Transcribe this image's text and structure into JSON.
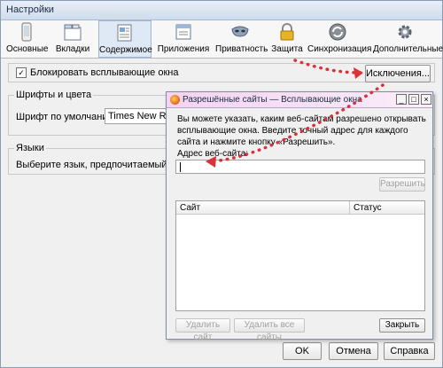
{
  "window": {
    "title": "Настройки"
  },
  "toolbar": {
    "items": [
      {
        "label": "Основные",
        "icon": "phone-icon"
      },
      {
        "label": "Вкладки",
        "icon": "tabs-icon"
      },
      {
        "label": "Содержимое",
        "icon": "content-icon"
      },
      {
        "label": "Приложения",
        "icon": "applications-icon"
      },
      {
        "label": "Приватность",
        "icon": "mask-icon"
      },
      {
        "label": "Защита",
        "icon": "lock-icon"
      },
      {
        "label": "Синхронизация",
        "icon": "sync-icon"
      },
      {
        "label": "Дополнительные",
        "icon": "gear-icon"
      }
    ],
    "selected": "Содержимое"
  },
  "content": {
    "block_popups": {
      "label": "Блокировать всплывающие окна",
      "checked": true
    },
    "exceptions_button": "Исключения...",
    "fonts": {
      "title": "Шрифты и цвета",
      "default_font_label": "Шрифт по умолчанию:",
      "default_font_value": "Times New Roman"
    },
    "languages": {
      "title": "Языки",
      "description": "Выберите язык, предпочитаемый вами для"
    }
  },
  "footer": {
    "ok": "OK",
    "cancel": "Отмена",
    "help": "Справка"
  },
  "dialog": {
    "title": "Разрешённые сайты — Всплывающие окна",
    "description": "Вы можете указать, каким веб-сайтам разрешено открывать всплывающие окна. Введите точный адрес для каждого сайта и нажмите кнопку «Разрешить».",
    "address_label": "Адрес веб-сайта:",
    "address_value": "",
    "allow_button": "Разрешить",
    "columns": [
      "Сайт",
      "Статус"
    ],
    "remove_site_button": "Удалить сайт",
    "remove_all_button": "Удалить все сайты",
    "close_button": "Закрыть"
  },
  "colors": {
    "annotation_arrow": "#d8323a",
    "selected_tab": "#dfe9f6"
  }
}
